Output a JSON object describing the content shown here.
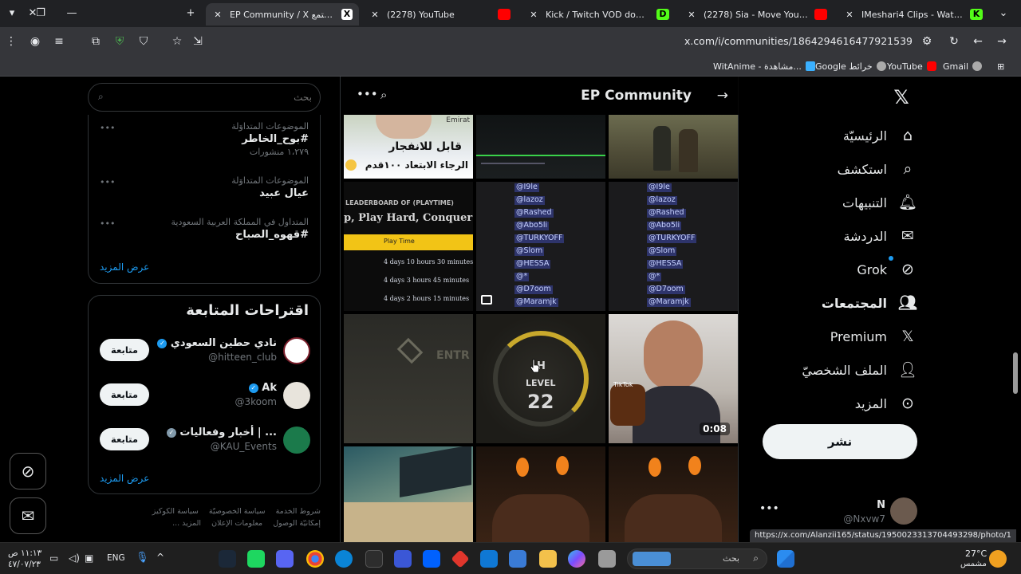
{
  "browser": {
    "tabs": [
      {
        "title": "EP Community / X المجتمع",
        "icon": "x-logo-icon",
        "active": true
      },
      {
        "title": "(2278) YouTube",
        "icon": "youtube-icon",
        "active": false
      },
      {
        "title": "Kick / Twitch VOD downloader",
        "icon": "d-logo-icon",
        "active": false
      },
      {
        "title": "(2278) Sia - Move Your Body (A",
        "icon": "youtube-icon",
        "active": false
      },
      {
        "title": "IMeshari4 Clips - Watch Live on",
        "icon": "kick-icon",
        "active": false
      }
    ],
    "url": "x.com/i/communities/1864294616477921539",
    "bookmarks": [
      "WitAnime - مشاهدة...",
      "Google خرائط",
      "YouTube",
      "Gmail"
    ],
    "status_url": "https://x.com/Alanzii165/status/1950023313704493298/photo/1"
  },
  "nav": {
    "items": [
      {
        "label": "الرئيسيّة",
        "icon": "home-icon",
        "bold": false
      },
      {
        "label": "استكشف",
        "icon": "search-icon",
        "bold": false
      },
      {
        "label": "التنبيهات",
        "icon": "bell-icon",
        "bold": false
      },
      {
        "label": "الدردشة",
        "icon": "mail-icon",
        "bold": false
      },
      {
        "label": "Grok",
        "icon": "grok-icon",
        "bold": false
      },
      {
        "label": "المجتمعات",
        "icon": "communities-icon",
        "bold": true
      },
      {
        "label": "Premium",
        "icon": "x-logo-icon",
        "bold": false
      },
      {
        "label": "الملف الشخصيّ",
        "icon": "profile-icon",
        "bold": false
      },
      {
        "label": "المزيد",
        "icon": "more-circle-icon",
        "bold": false
      }
    ],
    "post_label": "نشر",
    "account": {
      "name": "N",
      "handle": "@Nxvw7"
    }
  },
  "community": {
    "title": "EP Community",
    "tiles": {
      "t1_line1": "قابل للانفجار",
      "t1_line2": "الرجاء الابتعاد ١٠٠قدم",
      "t1_tag": "Emirat",
      "t4_head": "LEADERBOARD OF (PLAYTIME)",
      "t4_slogan": "p, Play Hard, Conquer Big",
      "t4_bar": "Play Time",
      "t4_row1": "4 days 10 hours 30 minutes",
      "t4_row2": "4 days 3 hours 45 minutes",
      "t4_row3": "4 days 2 hours 15 minutes",
      "t7_text": "ENTR",
      "t8_top": "H",
      "t8_level": "LEVEL",
      "t8_num": "22",
      "t9_duration": "0:08",
      "t9_badge": "TikTok"
    },
    "mentions": [
      "@I9le",
      "@lazoz",
      "@Rashed",
      "@Abo5li",
      "@TURKYOFF",
      "@Slom",
      "@HESSA",
      "@*",
      "@D7oom",
      "@Maramjk"
    ]
  },
  "left": {
    "search_placeholder": "بحث",
    "trends": [
      {
        "context": "الموضوعات المتداوَلة",
        "title": "#بوح_الخاطر",
        "count": "١،٢٧٩ منشورات"
      },
      {
        "context": "الموضوعات المتداوَلة",
        "title": "عيال عبيد",
        "count": ""
      },
      {
        "context": "المتداول في المملكة العربية السعودية",
        "title": "#قهوه_الصباح",
        "count": ""
      }
    ],
    "show_more": "عرض المزيد",
    "follow_title": "اقتراحات المتابعة",
    "follow": [
      {
        "name": "نادي حطين السعودي",
        "handle": "@hitteen_club",
        "button": "متابعة",
        "verified": "blue"
      },
      {
        "name": "Ak",
        "handle": "@3koom",
        "button": "متابعة",
        "verified": "blue"
      },
      {
        "name": "... | أخبار وفعاليات",
        "handle": "@KAU_Events",
        "button": "متابعة",
        "verified": "gray"
      }
    ],
    "footer": [
      "شروط الخدمة",
      "سياسة الخصوصيّة",
      "سياسة الكوكيز",
      "إمكانيّة الوصول",
      "معلومات الإعلان",
      "المزيد ..."
    ]
  },
  "taskbar": {
    "time": "١١:١٣ ص",
    "date": "٤٧/٠٧/٢٣",
    "lang": "ENG",
    "search": "بحث",
    "weather_temp": "27°C",
    "weather_desc": "مشمس"
  }
}
